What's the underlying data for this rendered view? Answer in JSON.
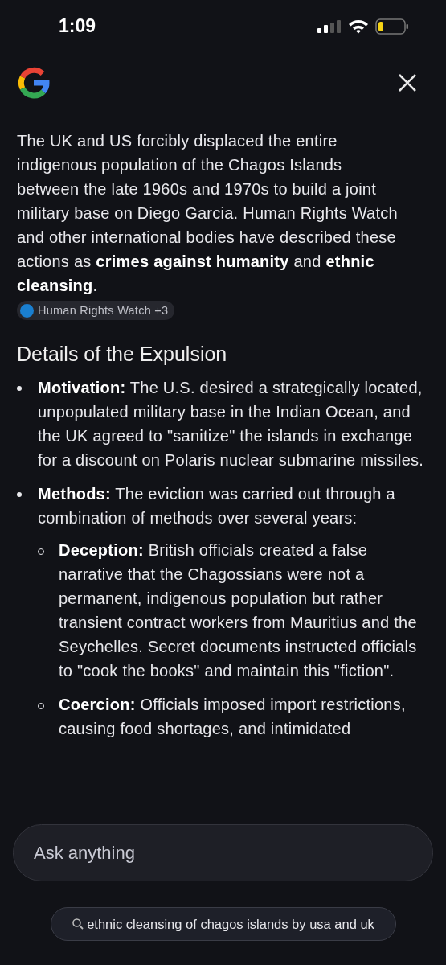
{
  "status_bar": {
    "time": "1:09"
  },
  "answer": {
    "paragraph": "The UK and US forcibly displaced the entire indigenous population of the Chagos Islands between the late 1960s and 1970s to build a joint military base on Diego Garcia. Human Rights Watch and other international bodies have described these actions as **crimes against humanity** and **ethnic cleansing**.",
    "source_chip": {
      "label": "Human Rights Watch +3",
      "color": "#1a7fd0"
    },
    "heading": "Details of the Expulsion",
    "bullets": [
      {
        "term": "Motivation:",
        "text": "The U.S. desired a strategically located, unpopulated military base in the Indian Ocean, and the UK agreed to \"sanitize\" the islands in exchange for a discount on Polaris nuclear submarine missiles."
      },
      {
        "term": "Methods:",
        "text": "The eviction was carried out through a combination of methods over several years:",
        "children": [
          {
            "term": "Deception:",
            "text": "British officials created a false narrative that the Chagossians were not a permanent, indigenous population but rather transient contract workers from Mauritius and the Seychelles. Secret documents instructed officials to \"cook the books\" and maintain this \"fiction\"."
          },
          {
            "term": "Coercion:",
            "text": "Officials imposed import restrictions, causing food shortages, and intimidated"
          }
        ]
      }
    ]
  },
  "ask_field": {
    "placeholder": "Ask anything"
  },
  "search_chip": {
    "query": "ethnic cleansing of chagos islands by usa and uk"
  }
}
